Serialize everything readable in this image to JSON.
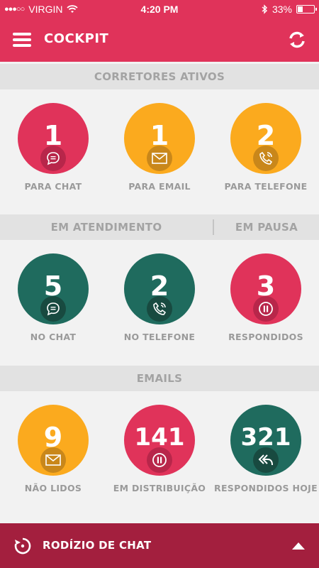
{
  "status_bar": {
    "carrier": "VIRGIN",
    "signal_dots": "●●●○○",
    "time": "4:20 PM",
    "battery": "33%",
    "battery_level": 0.33
  },
  "app_bar": {
    "title": "COCKPIT",
    "menu_icon": "hamburger-icon",
    "refresh_icon": "refresh-icon"
  },
  "sections": {
    "corretores": "CORRETORES ATIVOS",
    "em_atendimento": "EM ATENDIMENTO",
    "em_pausa": "EM PAUSA",
    "emails": "EMAILS"
  },
  "corretores": [
    {
      "value": "1",
      "label": "PARA CHAT",
      "icon": "chat-icon",
      "color": "#e0335a"
    },
    {
      "value": "1",
      "label": "PARA EMAIL",
      "icon": "mail-icon",
      "color": "#fbaa1e"
    },
    {
      "value": "2",
      "label": "PARA TELEFONE",
      "icon": "phone-icon",
      "color": "#fbaa1e"
    }
  ],
  "atendimento": [
    {
      "value": "5",
      "label": "NO CHAT",
      "icon": "chat-icon",
      "color": "#1f6b5e"
    },
    {
      "value": "2",
      "label": "NO TELEFONE",
      "icon": "phone-icon",
      "color": "#1f6b5e"
    },
    {
      "value": "3",
      "label": "RESPONDIDOS",
      "icon": "pause-icon",
      "color": "#e0335a"
    }
  ],
  "emails": [
    {
      "value": "9",
      "label": "NÃO LIDOS",
      "icon": "mail-icon",
      "color": "#fbaa1e"
    },
    {
      "value": "141",
      "label": "EM DISTRIBUIÇÃO",
      "icon": "pause-icon",
      "color": "#e0335a"
    },
    {
      "value": "321",
      "label": "RESPONDIDOS HOJE",
      "icon": "reply-all-icon",
      "color": "#1f6b5e"
    }
  ],
  "bottom_bar": {
    "title": "RODÍZIO DE CHAT",
    "icon": "rotate-icon",
    "toggle_icon": "arrow-up-icon"
  }
}
